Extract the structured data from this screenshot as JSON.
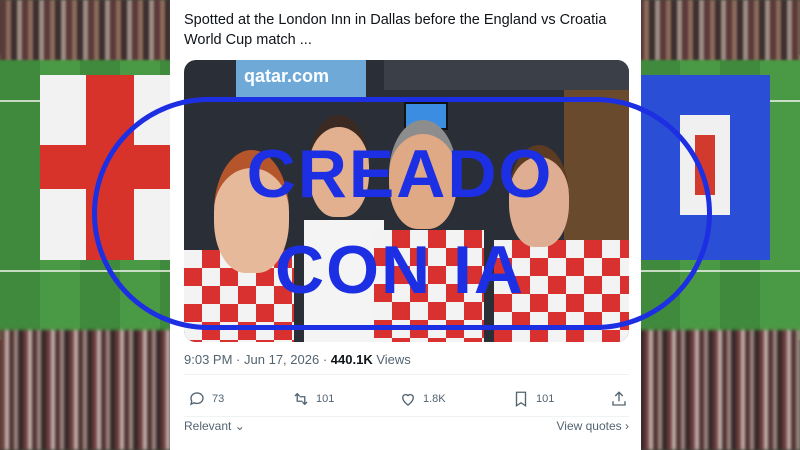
{
  "tweet": {
    "text": "Spotted at the London Inn in Dallas before the England vs Croatia World Cup match ...",
    "time": "9:03 PM",
    "separator": "·",
    "date": "Jun 17, 2026",
    "views_count": "440.1K",
    "views_label": "Views",
    "photo_sign_text": "qatar.com"
  },
  "actions": {
    "replies": "73",
    "reposts": "101",
    "likes": "1.8K",
    "bookmarks": "101"
  },
  "footer": {
    "relevant": "Relevant",
    "view_quotes": "View quotes"
  },
  "stamp": {
    "line1": "CREADO",
    "line2": "CON IA"
  },
  "colors": {
    "stamp_blue": "#1d2fe3",
    "text_primary": "#0f1419",
    "text_secondary": "#536471"
  }
}
